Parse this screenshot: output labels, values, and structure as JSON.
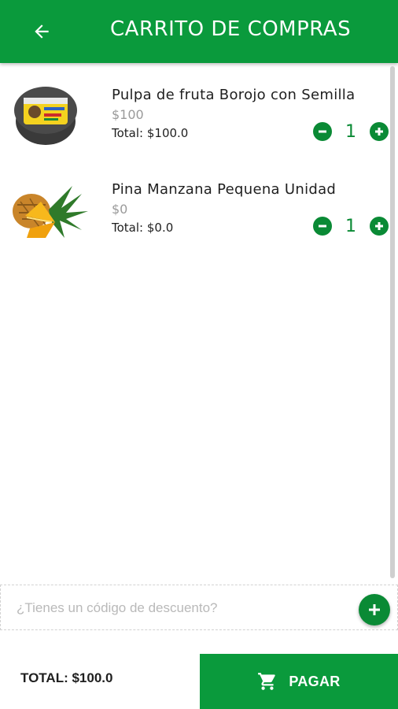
{
  "header": {
    "title": "CARRITO DE COMPRAS",
    "back_icon": "arrow-left-icon",
    "background": "#0a9a3c"
  },
  "cart": {
    "items": [
      {
        "name": "Pulpa de fruta Borojo con Semilla",
        "unit_price": "$100",
        "line_total": "Total: $100.0",
        "quantity": "1",
        "image": "borojo-pulp-container"
      },
      {
        "name": "Pina Manzana Pequena Unidad",
        "unit_price": "$0",
        "line_total": "Total: $0.0",
        "quantity": "1",
        "image": "pineapple"
      }
    ]
  },
  "coupon": {
    "placeholder": "¿Tienes un código de descuento?",
    "value": "",
    "add_icon": "plus-icon"
  },
  "footer": {
    "total": "TOTAL: $100.0",
    "pay_label": "PAGAR",
    "pay_icon": "cart-icon"
  },
  "colors": {
    "primary": "#0a9a3c",
    "accent": "#0a8a35"
  }
}
